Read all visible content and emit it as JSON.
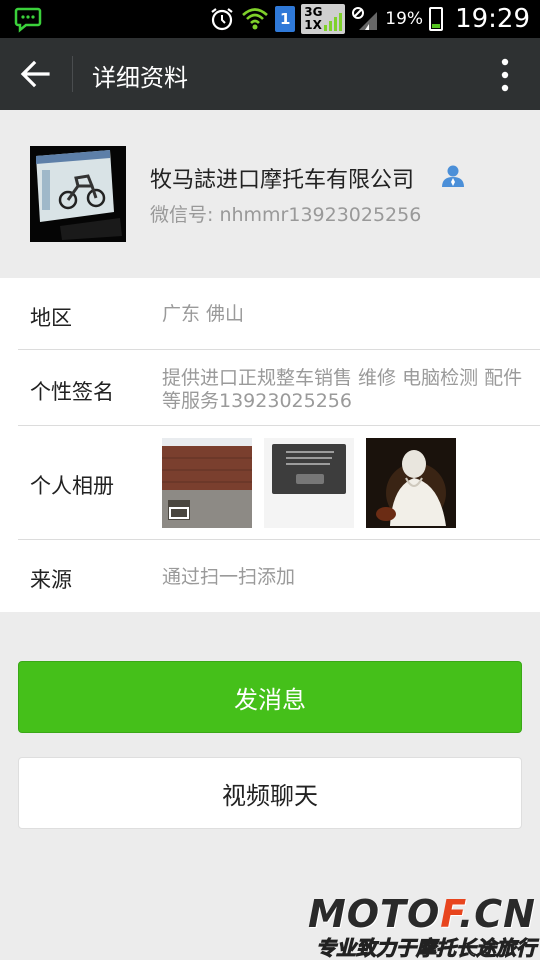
{
  "status_bar": {
    "sim_slot": "1",
    "network_label_top": "3G",
    "network_label_bottom": "1X",
    "battery_percent": "19%",
    "time": "19:29"
  },
  "action_bar": {
    "title": "详细资料"
  },
  "profile": {
    "name": "牧马誌进口摩托车有限公司",
    "wechat_id": "微信号: nhmmr13923025256"
  },
  "info": {
    "region": {
      "label": "地区",
      "value": "广东  佛山"
    },
    "signature": {
      "label": "个性签名",
      "value": "提供进口正规整车销售 维修 电脑检测 配件等服务13923025256"
    },
    "album": {
      "label": "个人相册"
    },
    "source": {
      "label": "来源",
      "value": "通过扫一扫添加"
    }
  },
  "buttons": {
    "send_message": "发消息",
    "video_chat": "视频聊天"
  },
  "watermark": {
    "main": "MOTOF.CN",
    "sub": "专业致力于摩托长途旅行"
  },
  "colors": {
    "action_bar": "#2e3132",
    "send_button": "#45c01a",
    "wm_accent": "#e8451e"
  }
}
